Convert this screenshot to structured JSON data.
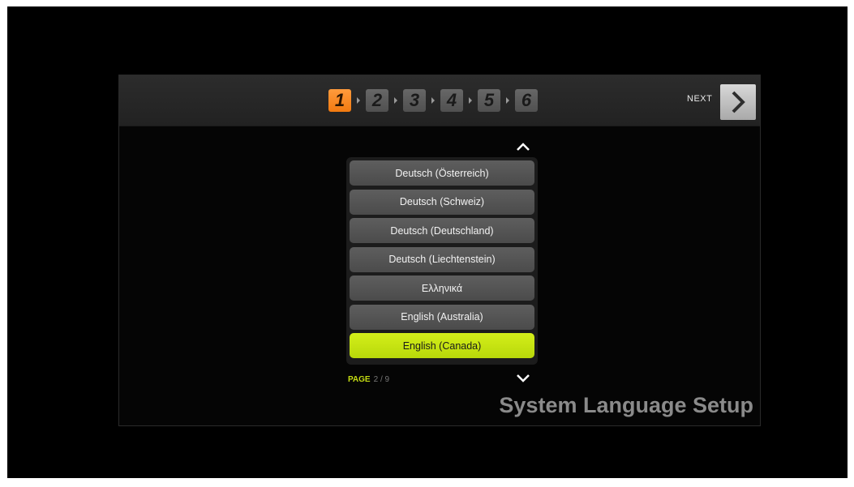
{
  "wizard": {
    "steps": [
      "1",
      "2",
      "3",
      "4",
      "5",
      "6"
    ],
    "active_step": "1",
    "next_label": "NEXT"
  },
  "language_list": {
    "items": [
      "Deutsch (Österreich)",
      "Deutsch (Schweiz)",
      "Deutsch (Deutschland)",
      "Deutsch (Liechtenstein)",
      "Ελληνικά",
      "English (Australia)",
      "English (Canada)"
    ],
    "selected": "English (Canada)"
  },
  "pagination": {
    "label": "PAGE",
    "value": "2 / 9"
  },
  "screen_title": "System Language Setup",
  "colors": {
    "active_step": "#f27a10",
    "selected_item": "#c8e310",
    "page_label": "#c4dc12",
    "background": "#000000"
  },
  "icons": {
    "next": "chevron-right-icon",
    "scroll_up": "chevron-up-icon",
    "scroll_down": "chevron-down-icon"
  }
}
